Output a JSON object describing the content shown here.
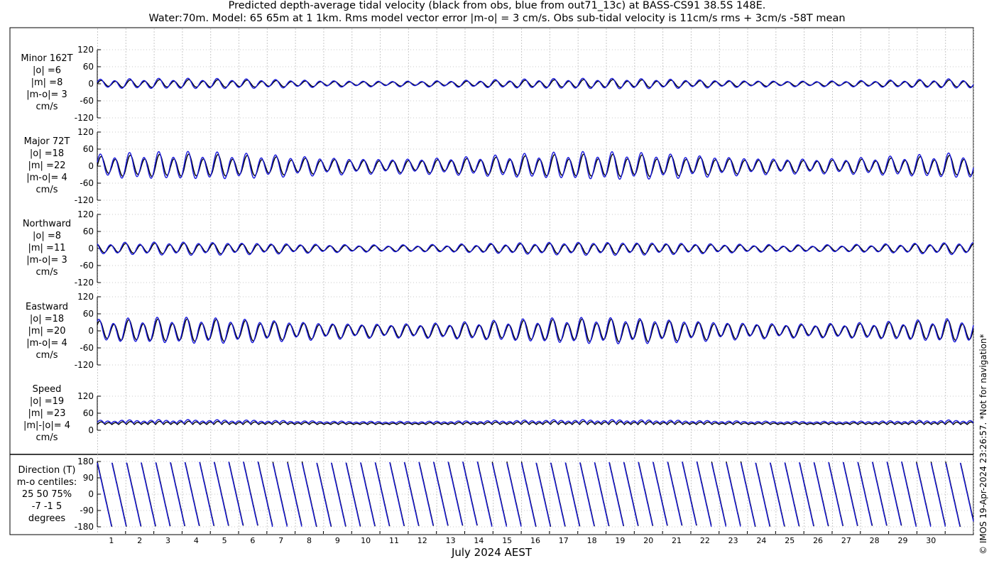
{
  "title": {
    "line1": "Predicted depth-average tidal velocity (black from obs, blue from out71_13c) at BASS-CS91 38.5S 148E.",
    "line2": "Water:70m. Model: 65 65m at 1 1km. Rms model vector error |m-o| = 3 cm/s. Obs sub-tidal velocity is 11cm/s rms + 3cm/s -58T mean"
  },
  "xlabel": "July 2024 AEST",
  "credit": "© IMOS 19-Apr-2024 23:26:57. *Not for navigation*",
  "colors": {
    "obs": "#000000",
    "model": "#1a1adc",
    "grid": "#c8c8c8"
  },
  "chart_data": [
    {
      "type": "line",
      "label_lines": [
        "Minor 162T",
        "|o| =6",
        "|m| =8",
        "|m-o|= 3",
        "cm/s"
      ],
      "ylim": [
        -120,
        120
      ],
      "yticks": [
        "120",
        "60",
        "0",
        "-60",
        "-120"
      ],
      "xlim": [
        0,
        31
      ],
      "xticks": [
        "1",
        "2",
        "3",
        "4",
        "5",
        "6",
        "7",
        "8",
        "9",
        "10",
        "11",
        "12",
        "13",
        "14",
        "15",
        "16",
        "17",
        "18",
        "19",
        "20",
        "21",
        "22",
        "23",
        "24",
        "25",
        "26",
        "27",
        "28",
        "29",
        "30"
      ],
      "series": [
        {
          "amplitude": 9,
          "offset": 0,
          "scale": 1.0,
          "phase": 0.0
        },
        {
          "amplitude": 12,
          "offset": 0,
          "scale": 1.0,
          "phase": 0.05
        }
      ]
    },
    {
      "type": "line",
      "label_lines": [
        "Major 72T",
        "|o| =18",
        "|m| =22",
        "|m-o|= 4",
        "cm/s"
      ],
      "ylim": [
        -120,
        120
      ],
      "yticks": [
        "120",
        "60",
        "0",
        "-60",
        "-120"
      ],
      "xlim": [
        0,
        31
      ],
      "xticks": [
        "1",
        "2",
        "3",
        "4",
        "5",
        "6",
        "7",
        "8",
        "9",
        "10",
        "11",
        "12",
        "13",
        "14",
        "15",
        "16",
        "17",
        "18",
        "19",
        "20",
        "21",
        "22",
        "23",
        "24",
        "25",
        "26",
        "27",
        "28",
        "29",
        "30"
      ],
      "series": [
        {
          "amplitude": 26,
          "offset": 0,
          "scale": 1.0,
          "phase": 0.0
        },
        {
          "amplitude": 32,
          "offset": 0,
          "scale": 1.0,
          "phase": 0.05
        }
      ]
    },
    {
      "type": "line",
      "label_lines": [
        "Northward",
        "|o| =8",
        "|m| =11",
        "|m-o|= 3",
        "cm/s"
      ],
      "ylim": [
        -120,
        120
      ],
      "yticks": [
        "120",
        "60",
        "0",
        "-60",
        "-120"
      ],
      "xlim": [
        0,
        31
      ],
      "xticks": [
        "1",
        "2",
        "3",
        "4",
        "5",
        "6",
        "7",
        "8",
        "9",
        "10",
        "11",
        "12",
        "13",
        "14",
        "15",
        "16",
        "17",
        "18",
        "19",
        "20",
        "21",
        "22",
        "23",
        "24",
        "25",
        "26",
        "27",
        "28",
        "29",
        "30"
      ],
      "series": [
        {
          "amplitude": 12,
          "offset": 0,
          "scale": 1.0,
          "phase": 0.3
        },
        {
          "amplitude": 15,
          "offset": 0,
          "scale": 1.0,
          "phase": 0.35
        }
      ]
    },
    {
      "type": "line",
      "label_lines": [
        "Eastward",
        "|o| =18",
        "|m| =20",
        "|m-o|= 4",
        "cm/s"
      ],
      "ylim": [
        -120,
        120
      ],
      "yticks": [
        "120",
        "60",
        "0",
        "-60",
        "-120"
      ],
      "xlim": [
        0,
        31
      ],
      "xticks": [
        "1",
        "2",
        "3",
        "4",
        "5",
        "6",
        "7",
        "8",
        "9",
        "10",
        "11",
        "12",
        "13",
        "14",
        "15",
        "16",
        "17",
        "18",
        "19",
        "20",
        "21",
        "22",
        "23",
        "24",
        "25",
        "26",
        "27",
        "28",
        "29",
        "30"
      ],
      "series": [
        {
          "amplitude": 26,
          "offset": 0,
          "scale": 1.0,
          "phase": 0.1
        },
        {
          "amplitude": 30,
          "offset": 0,
          "scale": 1.0,
          "phase": 0.15
        }
      ]
    },
    {
      "type": "line",
      "label_lines": [
        "Speed",
        "|o| =19",
        "|m| =23",
        "|m|-|o|= 4",
        "cm/s"
      ],
      "ylim": [
        0,
        120
      ],
      "yticks": [
        "120",
        "60",
        "0"
      ],
      "xlim": [
        0,
        31
      ],
      "xticks": [
        "1",
        "2",
        "3",
        "4",
        "5",
        "6",
        "7",
        "8",
        "9",
        "10",
        "11",
        "12",
        "13",
        "14",
        "15",
        "16",
        "17",
        "18",
        "19",
        "20",
        "21",
        "22",
        "23",
        "24",
        "25",
        "26",
        "27",
        "28",
        "29",
        "30"
      ],
      "series": [
        {
          "amplitude": 12,
          "offset": 20,
          "scale": 1.0,
          "phase": 0.0
        },
        {
          "amplitude": 14,
          "offset": 24,
          "scale": 1.0,
          "phase": 0.05
        }
      ]
    },
    {
      "type": "line",
      "label_lines": [
        "Direction (T)",
        "m-o centiles:",
        "25  50  75%",
        "-7 -1  5",
        "degrees"
      ],
      "ylim": [
        -180,
        180
      ],
      "yticks": [
        "180",
        "90",
        "0",
        "-90",
        "-180"
      ],
      "xlim": [
        0,
        31
      ],
      "xticks": [
        "1",
        "2",
        "3",
        "4",
        "5",
        "6",
        "7",
        "8",
        "9",
        "10",
        "11",
        "12",
        "13",
        "14",
        "15",
        "16",
        "17",
        "18",
        "19",
        "20",
        "21",
        "22",
        "23",
        "24",
        "25",
        "26",
        "27",
        "28",
        "29",
        "30"
      ],
      "series": [
        {
          "amplitude": 180,
          "offset": 0,
          "scale": 1.0,
          "phase": 0.0
        },
        {
          "amplitude": 180,
          "offset": 0,
          "scale": 1.0,
          "phase": 0.02
        }
      ]
    }
  ]
}
